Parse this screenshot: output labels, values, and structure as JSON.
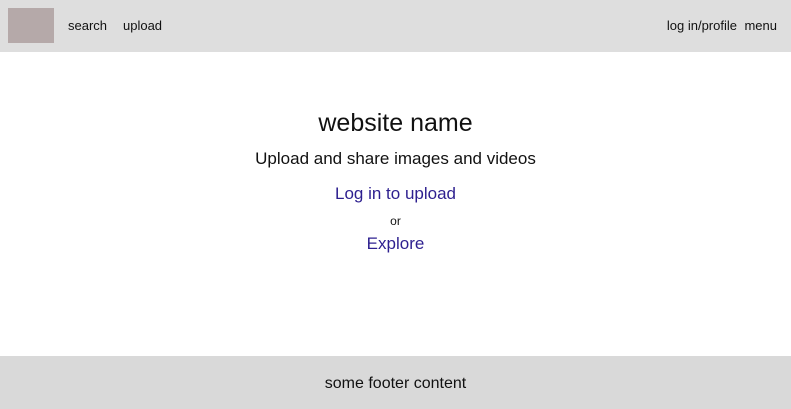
{
  "header": {
    "logo_name": "site-logo",
    "nav": {
      "search_label": "search",
      "upload_label": "upload",
      "login_profile_label": "log in/profile",
      "menu_label": "menu"
    }
  },
  "hero": {
    "title": "website name",
    "subtitle": "Upload and share images and videos",
    "login_link_label": "Log in to upload",
    "or_label": "or",
    "explore_link_label": "Explore"
  },
  "footer": {
    "text": "some footer content"
  },
  "colors": {
    "header_background": "#dedede",
    "logo_placeholder": "#b5a9a9",
    "link": "#2d1f8f",
    "footer_background": "#d9d9d9"
  }
}
